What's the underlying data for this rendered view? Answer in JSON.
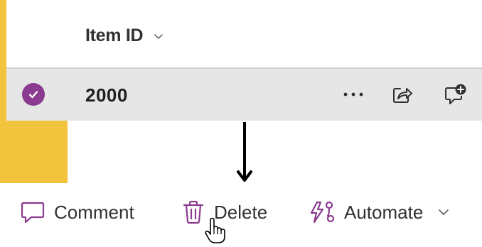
{
  "list": {
    "column_header": "Item ID",
    "rows": [
      {
        "item_id": "2000",
        "selected": true
      }
    ]
  },
  "toolbar": {
    "comment_label": "Comment",
    "delete_label": "Delete",
    "automate_label": "Automate"
  },
  "colors": {
    "accent": "#8a3b8f",
    "highlight_yellow": "#f2c43d",
    "row_selected_bg": "#e6e6e6"
  },
  "icons": {
    "header_chevron": "chevron-down-icon",
    "check": "check-circle-icon",
    "more": "more-icon",
    "share": "share-icon",
    "comment_add": "add-comment-icon",
    "comment": "comment-icon",
    "delete": "trash-icon",
    "automate": "automate-icon",
    "automate_chevron": "chevron-down-icon",
    "arrow": "arrow-down-icon",
    "cursor": "hand-cursor-icon"
  }
}
